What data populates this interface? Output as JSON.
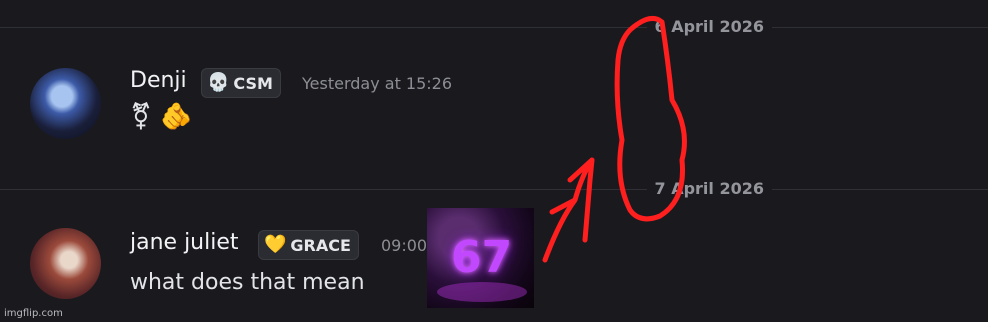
{
  "dividers": [
    {
      "date": "6 April 2026"
    },
    {
      "date": "7 April 2026"
    }
  ],
  "messages": [
    {
      "username": "Denji",
      "tag": {
        "label": "CSM",
        "icon": "skull-icon",
        "glyph": "💀"
      },
      "timestamp": "Yesterday at 15:26",
      "content": "⚧ 🫵"
    },
    {
      "username": "jane juliet",
      "tag": {
        "label": "GRACE",
        "icon": "yellow-heart-icon",
        "glyph": "💛"
      },
      "timestamp": "09:00",
      "content": "what does that mean"
    }
  ],
  "overlay_image": {
    "text": "67"
  },
  "watermark": "imgflip.com",
  "colors": {
    "background": "#1a1a1e",
    "scribble": "#ff1f1f"
  }
}
